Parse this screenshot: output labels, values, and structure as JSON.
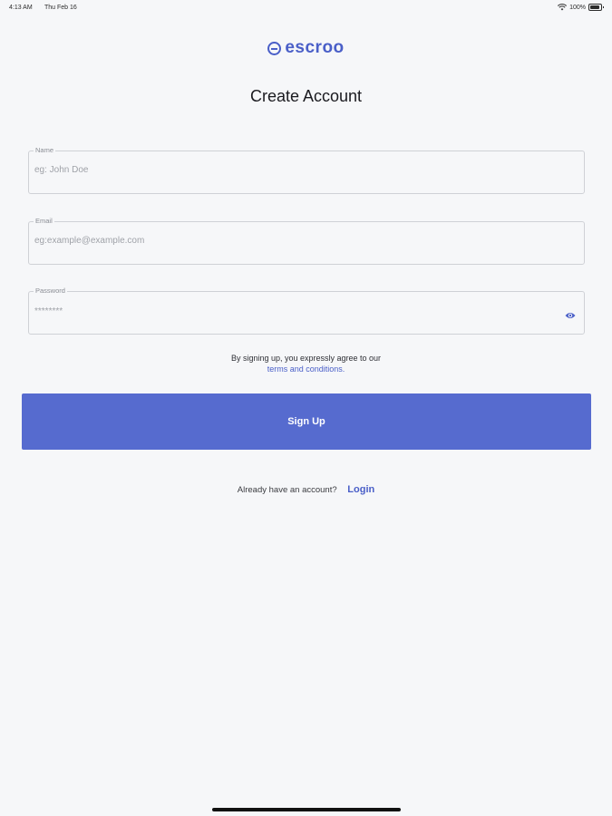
{
  "status_bar": {
    "time": "4:13 AM",
    "date": "Thu Feb 16",
    "battery": "100%"
  },
  "brand": {
    "name": "escroo",
    "color": "#4a5fc8"
  },
  "page_title": "Create Account",
  "form": {
    "name": {
      "label": "Name",
      "placeholder": "eg: John Doe",
      "value": ""
    },
    "email": {
      "label": "Email",
      "placeholder": "eg:example@example.com",
      "value": ""
    },
    "password": {
      "label": "Password",
      "placeholder": "********",
      "value": "",
      "toggle_icon": "eye-icon"
    }
  },
  "terms": {
    "text": "By signing up, you expressly agree to our",
    "link_label": "terms and conditions."
  },
  "signup_button": {
    "label": "Sign Up",
    "color": "#566bcf"
  },
  "login": {
    "prompt": "Already have an account?",
    "link_label": "Login"
  }
}
